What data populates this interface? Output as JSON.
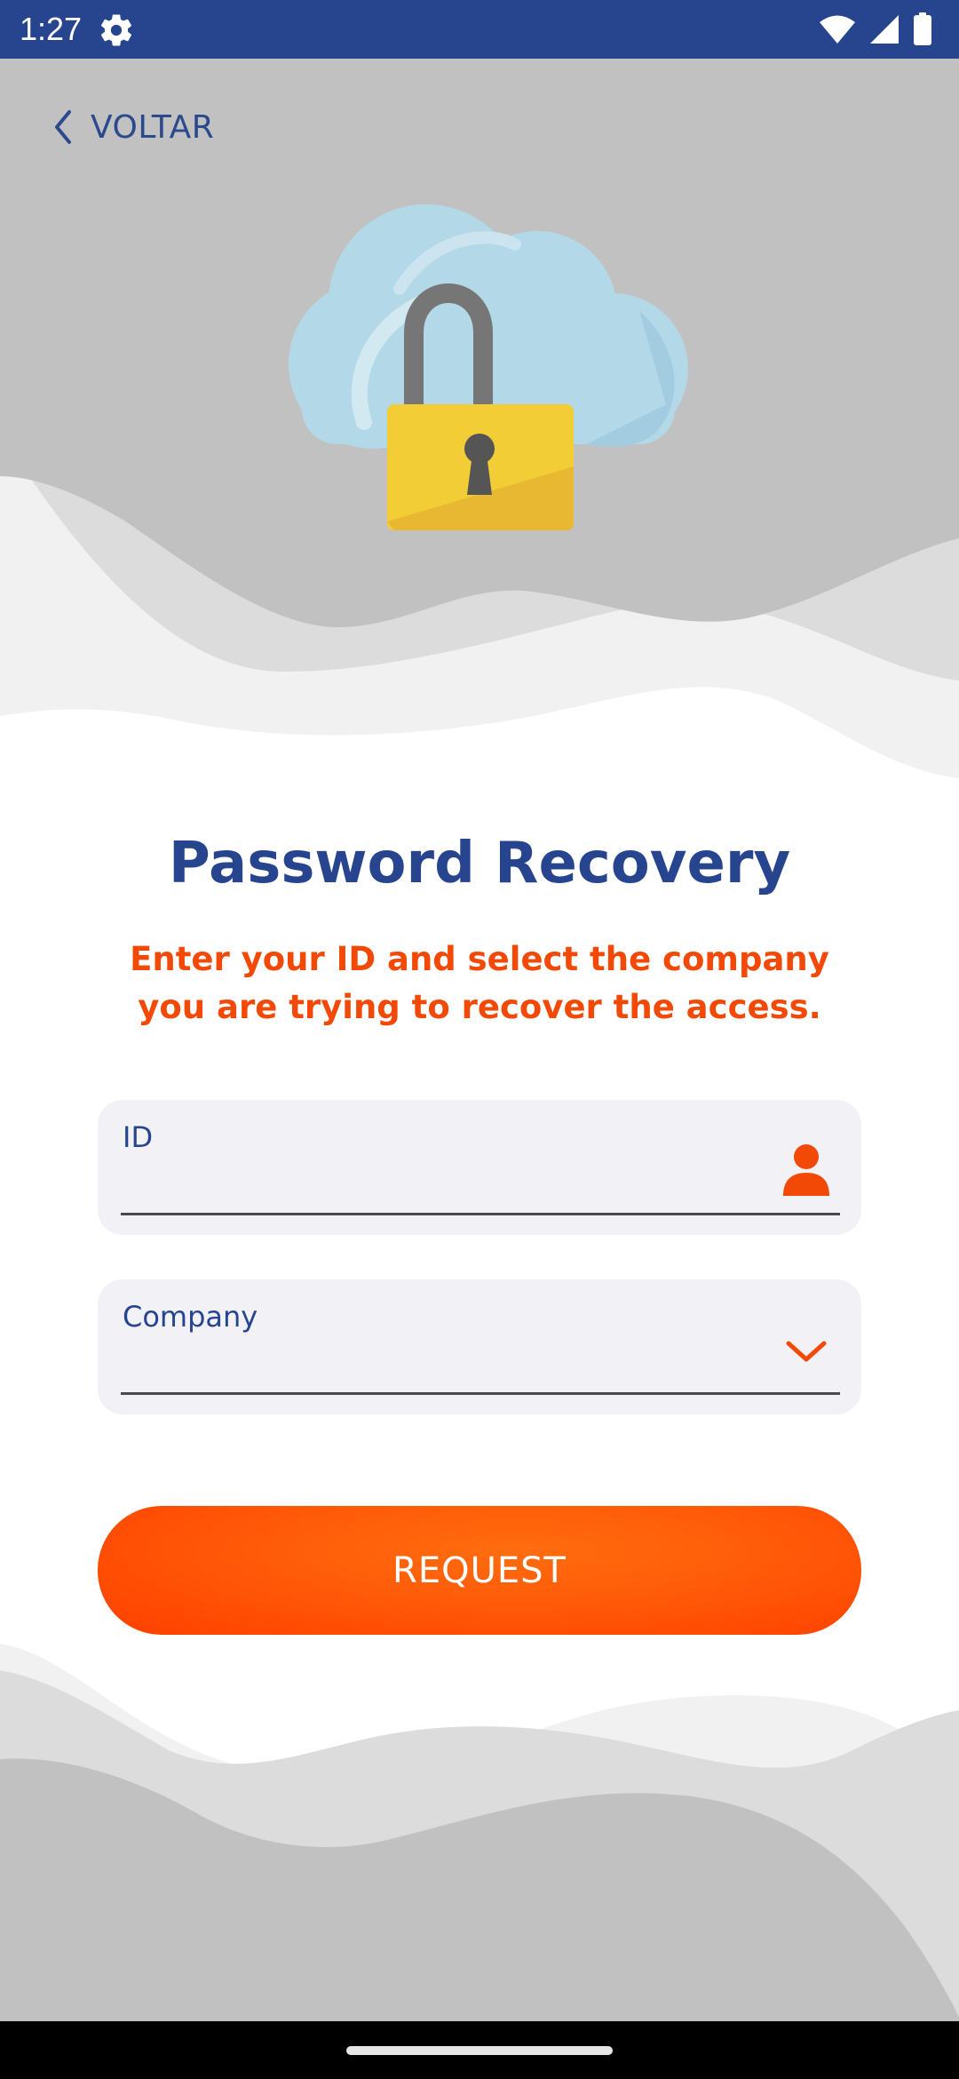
{
  "status_bar": {
    "time": "1:27",
    "icons": [
      "settings-gear-icon",
      "wifi-icon",
      "cellular-signal-icon",
      "battery-icon"
    ]
  },
  "nav": {
    "back_label": "VOLTAR"
  },
  "illustration": {
    "description_icons": [
      "cloud-icon",
      "padlock-icon"
    ]
  },
  "page": {
    "title": "Password Recovery",
    "subtitle": "Enter your ID and select the company you are trying to recover the access."
  },
  "form": {
    "id_field": {
      "label": "ID",
      "value": "",
      "icon": "user-icon"
    },
    "company_field": {
      "label": "Company",
      "selected": "",
      "icon": "chevron-down-icon"
    },
    "submit_label": "REQUEST"
  },
  "colors": {
    "primary": "#27458f",
    "accent": "#f24a06",
    "button": "#ff5a08",
    "field_bg": "#f2f1f6",
    "status_bar": "#27458f"
  }
}
